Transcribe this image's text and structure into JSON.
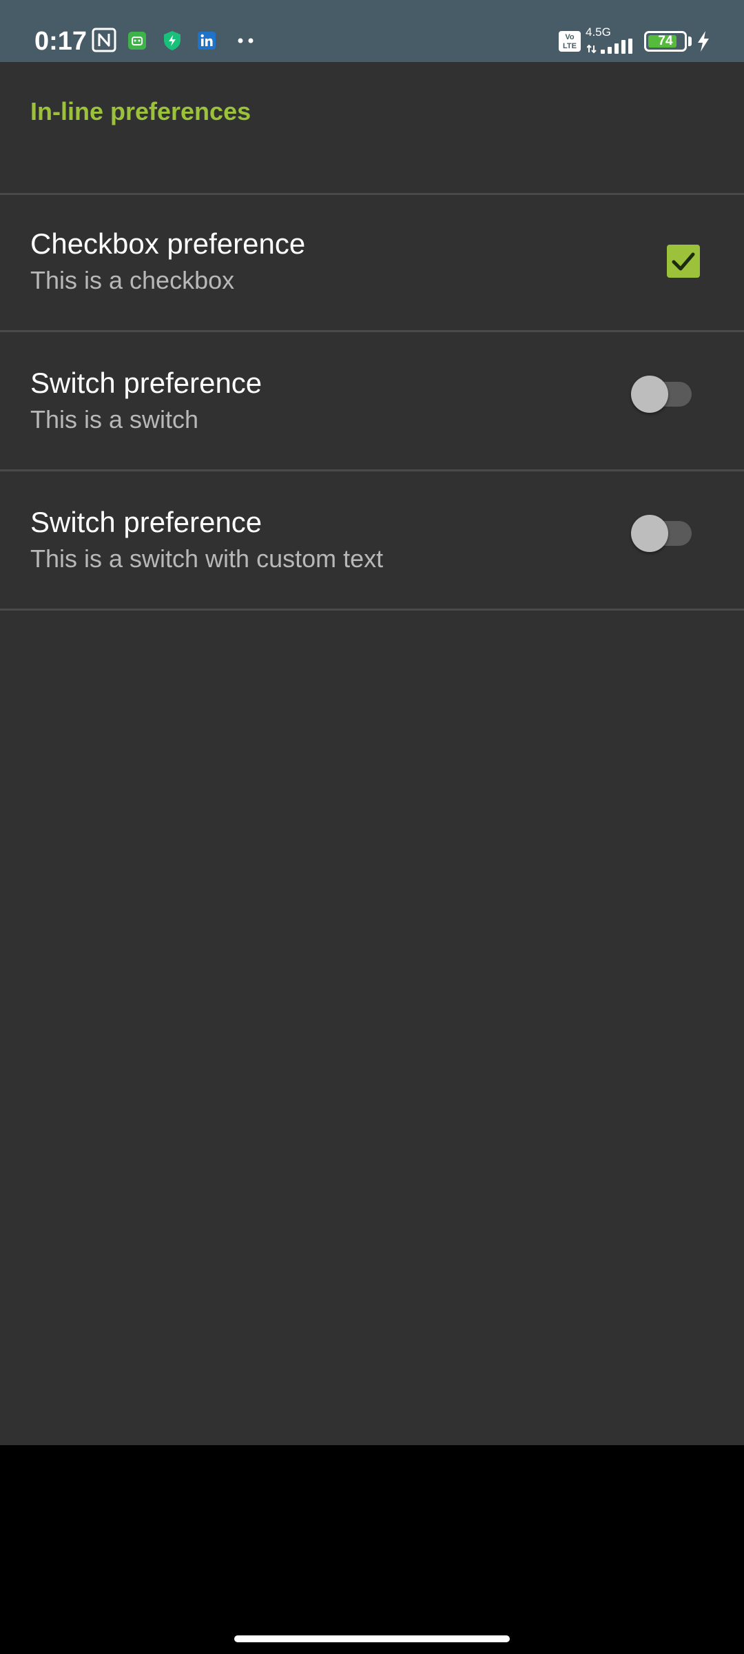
{
  "status_bar": {
    "time": "0:17",
    "network_type": "4.5G",
    "volte": "Vo LTE",
    "battery_level": "74",
    "icons": [
      "nfc-icon",
      "android-app-icon",
      "vpn-shield-icon",
      "linkedin-icon",
      "more-dots-icon",
      "volte-icon",
      "signal-icon",
      "battery-icon",
      "charging-icon"
    ],
    "colors": {
      "background": "#485c68",
      "battery_fill": "#55bb3a"
    }
  },
  "preferences": {
    "category_title": "In-line preferences",
    "items": [
      {
        "title": "Checkbox preference",
        "summary": "This is a checkbox",
        "control": "checkbox",
        "checked": true
      },
      {
        "title": "Switch preference",
        "summary": "This is a switch",
        "control": "switch",
        "checked": false
      },
      {
        "title": "Switch preference",
        "summary": "This is a switch with custom text",
        "control": "switch",
        "checked": false
      }
    ],
    "colors": {
      "accent": "#9bc23a",
      "background": "#313131"
    }
  }
}
